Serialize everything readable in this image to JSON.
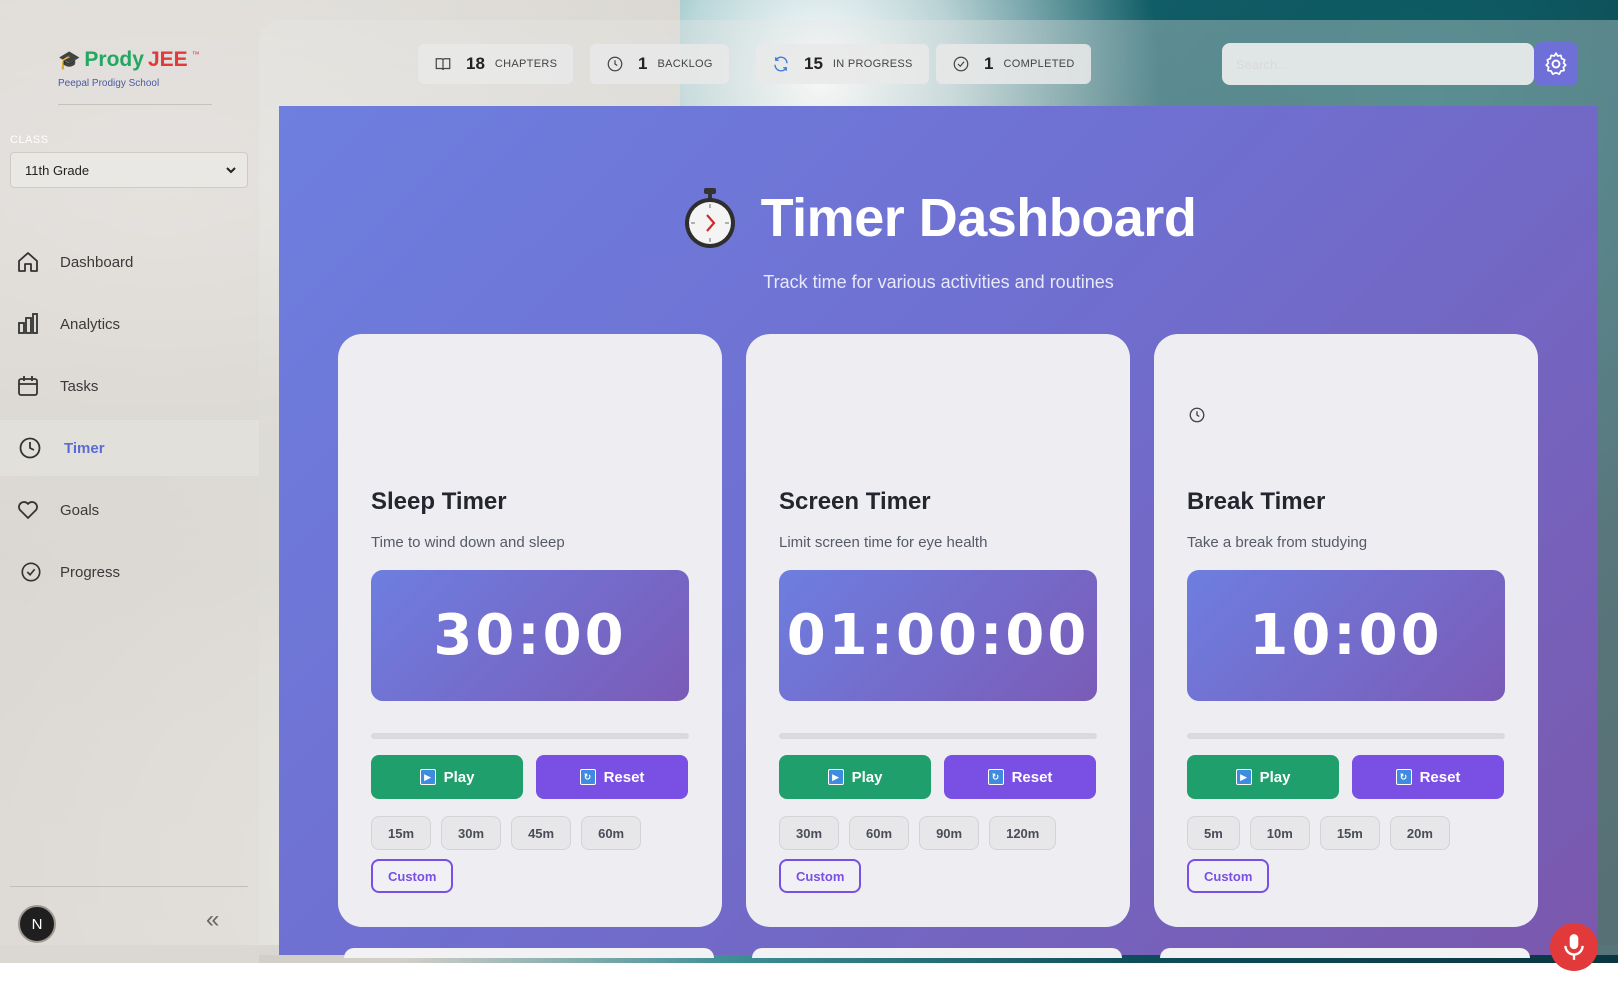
{
  "brand": {
    "name_a": "Prody",
    "name_b": "JEE",
    "tm": "™",
    "subtitle": "Peepal Prodigy School"
  },
  "sidebar": {
    "class_label": "CLASS",
    "class_value": "11th Grade",
    "items": [
      {
        "label": "Dashboard",
        "icon": "home-icon"
      },
      {
        "label": "Analytics",
        "icon": "bar-chart-icon"
      },
      {
        "label": "Tasks",
        "icon": "calendar-icon"
      },
      {
        "label": "Timer",
        "icon": "clock-icon",
        "active": true
      },
      {
        "label": "Goals",
        "icon": "heart-icon"
      },
      {
        "label": "Progress",
        "icon": "check-circle-icon"
      }
    ],
    "avatar_initial": "N",
    "collapse_glyph": "«"
  },
  "stats": [
    {
      "value": "18",
      "caption": "CHAPTERS",
      "icon": "book-icon"
    },
    {
      "value": "1",
      "caption": "BACKLOG",
      "icon": "clock-icon"
    },
    {
      "value": "15",
      "caption": "IN PROGRESS",
      "icon": "refresh-icon"
    },
    {
      "value": "1",
      "caption": "COMPLETED",
      "icon": "check-circle-icon"
    }
  ],
  "search": {
    "placeholder": "Search..."
  },
  "hero": {
    "title": "Timer Dashboard",
    "subtitle": "Track time for various activities and routines"
  },
  "timers": [
    {
      "title": "Sleep Timer",
      "desc": "Time to wind down and sleep",
      "time": "30:00",
      "progress": 0,
      "play": "Play",
      "reset": "Reset",
      "presets": [
        "15m",
        "30m",
        "45m",
        "60m"
      ],
      "custom": "Custom"
    },
    {
      "title": "Screen Timer",
      "desc": "Limit screen time for eye health",
      "time": "01:00:00",
      "progress": 0,
      "play": "Play",
      "reset": "Reset",
      "presets": [
        "30m",
        "60m",
        "90m",
        "120m"
      ],
      "custom": "Custom"
    },
    {
      "title": "Break Timer",
      "desc": "Take a break from studying",
      "time": "10:00",
      "progress": 0,
      "play": "Play",
      "reset": "Reset",
      "presets": [
        "5m",
        "10m",
        "15m",
        "20m"
      ],
      "custom": "Custom"
    }
  ],
  "colors": {
    "accent": "#6f6fd8",
    "play": "#1f9f6c",
    "reset": "#7a4fe3",
    "brand_green": "#22a861",
    "brand_red": "#e03a3a"
  }
}
